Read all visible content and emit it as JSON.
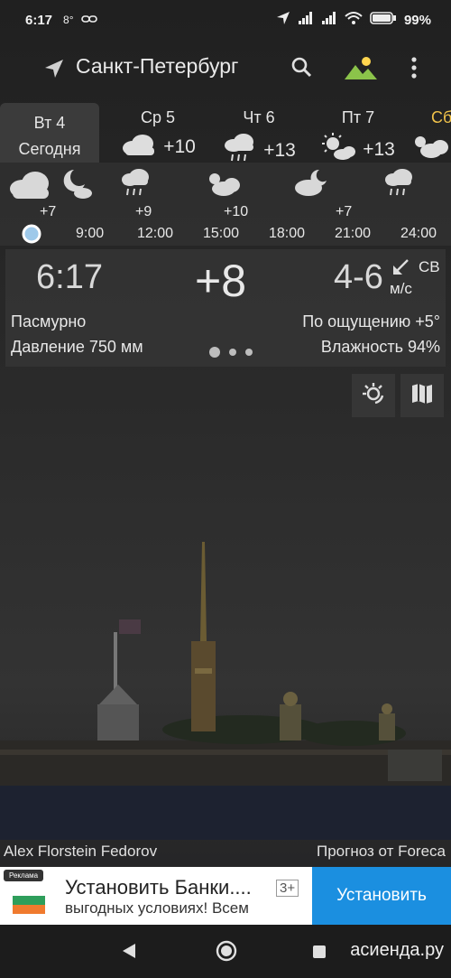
{
  "status_bar": {
    "time": "6:17",
    "notification": "8°",
    "battery": "99%"
  },
  "toolbar": {
    "city": "Санкт-Петербург",
    "icons": [
      "location-arrow-icon",
      "search-icon",
      "landscape-icon",
      "more-vert-icon"
    ]
  },
  "days": [
    {
      "name": "Вт 4",
      "sub": "Сегодня"
    },
    {
      "name": "Ср 5",
      "temp": "+10",
      "icon": "cloud-icon"
    },
    {
      "name": "Чт 6",
      "temp": "+13",
      "icon": "cloud-rain-icon"
    },
    {
      "name": "Пт 7",
      "temp": "+13",
      "icon": "sun-cloud-icon"
    },
    {
      "name": "Сб",
      "icon": "sun-cloud-icon"
    }
  ],
  "hourly": [
    {
      "temp": "+7",
      "hour": "",
      "icon": "cloud-moon-icon"
    },
    {
      "temp": "",
      "hour": "9:00",
      "icon": ""
    },
    {
      "temp": "+9",
      "hour": "12:00",
      "icon": "cloud-rain-icon"
    },
    {
      "temp": "+10",
      "hour": "15:00",
      "icon": "sun-cloud-icon"
    },
    {
      "temp": "",
      "hour": "18:00",
      "icon": ""
    },
    {
      "temp": "+7",
      "hour": "21:00",
      "icon": "moon-cloud-icon"
    },
    {
      "temp": "",
      "hour": "24:00",
      "icon": "cloud-rain-icon"
    }
  ],
  "current": {
    "time": "6:17",
    "temp": "+8",
    "wind": "4-6",
    "wind_dir": "СВ",
    "wind_unit": "м/с",
    "condition": "Пасмурно",
    "pressure": "Давление 750 мм",
    "feels_like": "По ощущению +5°",
    "humidity": "Влажность 94%"
  },
  "credits": {
    "photo_author": "Alex Florstein Fedorov",
    "provider": "Прогноз от Foreca"
  },
  "ad": {
    "label": "Реклама",
    "title": "Установить Банки....",
    "subtitle": "выгодных условиях! Всем",
    "age": "3+",
    "button": "Установить"
  },
  "watermark": "асиенда.ру",
  "colors": {
    "accent_green": "#8bc34a",
    "accent_yellow": "#ffd54f",
    "today_bg": "#3b3b3b",
    "install_button": "#1b8fe0"
  }
}
